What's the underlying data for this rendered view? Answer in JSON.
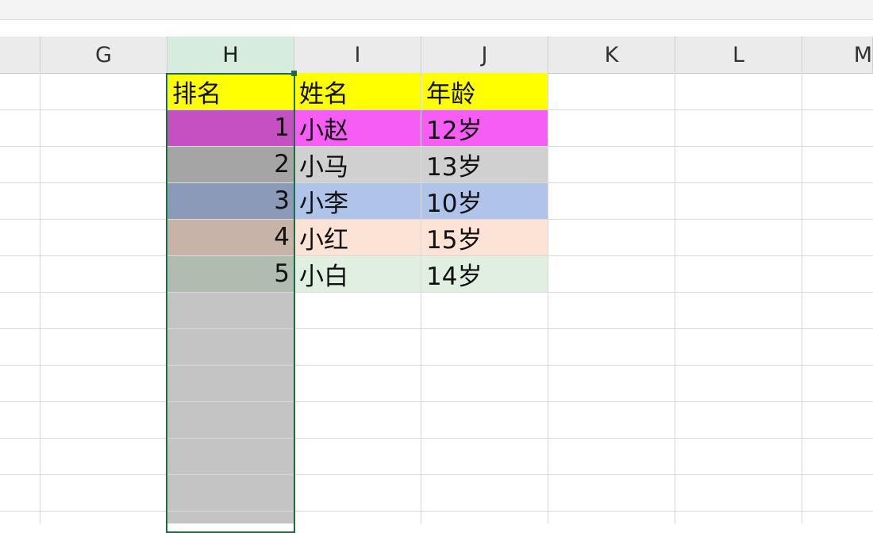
{
  "columns": [
    "G",
    "H",
    "I",
    "J",
    "K",
    "L",
    "M"
  ],
  "selected_column": "H",
  "headers": {
    "rank": "排名",
    "name": "姓名",
    "age": "年龄"
  },
  "rows": [
    {
      "rank": "1",
      "name": "小赵",
      "age": "12岁"
    },
    {
      "rank": "2",
      "name": "小马",
      "age": "13岁"
    },
    {
      "rank": "3",
      "name": "小李",
      "age": "10岁"
    },
    {
      "rank": "4",
      "name": "小红",
      "age": "15岁"
    },
    {
      "rank": "5",
      "name": "小白",
      "age": "14岁"
    }
  ],
  "colors": {
    "header_fill": "#ffff00",
    "row_fills": [
      "#f65df5",
      "#d0d0d0",
      "#b0c4ea",
      "#fde3d6",
      "#e1efe0"
    ],
    "rank_fills": [
      "#c550c2",
      "#a5a5a5",
      "#8b9ab8",
      "#c7b3a8",
      "#b1bcb0"
    ],
    "selection_shade": "#c4c4c4",
    "selection_border": "#1f6b46",
    "selected_header": "#d5ecdf"
  }
}
